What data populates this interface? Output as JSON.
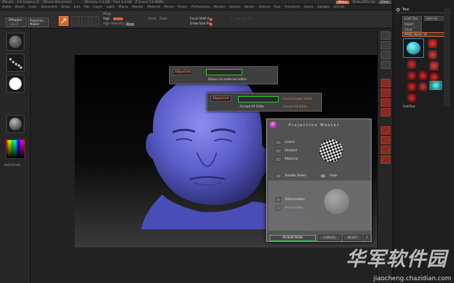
{
  "titlebar": {
    "items": [
      "ZBrush",
      "2.0 (Legacy 4)",
      "ZBrush Document",
      "Memory: 2.4 GB",
      "Free 3.4 GB",
      "Z-Scene 3.6 NBBV"
    ],
    "menu_button": "Menu",
    "default_script": "DefaultZScript",
    "clear": "Clear"
  },
  "menubar": {
    "items": [
      "Alpha",
      "Brush",
      "Color",
      "Document",
      "Draw",
      "Edit",
      "File",
      "Layer",
      "Light",
      "Macro",
      "Marker",
      "Material",
      "Movie",
      "Picker",
      "Preferences",
      "Render",
      "Stencil",
      "Stroke",
      "Texture",
      "Tool",
      "Transform",
      "Zoom",
      "Zplugin",
      "Zscript"
    ]
  },
  "toolbar": {
    "zmapper": "ZMapper",
    "zmapper_rev": "rev E",
    "projection_master": "Projection Master",
    "mrgb": "Mrgb",
    "rgb": "Rgb",
    "rgb_intensity": "Rgb Intensity 75",
    "zadd": "Zadd",
    "zsub": "Zsub",
    "focal_shift": "Focal Shift 0",
    "draw_size": "Draw Size 64",
    "z_intensity": "Z Intensity 25"
  },
  "left_shelf": {
    "color_label": "SwitchColor"
  },
  "tray": {
    "header": "Tool",
    "load_tool": "Load Tool",
    "save_as": "Save As",
    "import": "Import",
    "clone": "Clone",
    "current_tool": "PM3D_Merlin 19",
    "subtool_label": "SubTool"
  },
  "popups": {
    "return_to_editor": "Return to external editor",
    "cancel_layer_edits": "Cancel Layer Edits",
    "accept_all_edits": "Accept All Edits",
    "cancel_all_edits": "Cancel All Edits",
    "zapplink": "ZAppLink"
  },
  "projection_master": {
    "title": "Projection Master",
    "colors": "Colors",
    "shaded": "Shaded",
    "material": "Material",
    "double_sided": "Double Sided",
    "fade": "Fade",
    "deformation": "Deformation",
    "normalized": "Normalized",
    "pickup_now": "PICKUP NOW",
    "cancel": "CANCEL",
    "reset": "RESET",
    "help": "?"
  },
  "watermark": {
    "text": "华军软件园",
    "url": "jiaocheng.chazidian.com"
  },
  "colors": {
    "accent": "#d9652a",
    "highlight_box": "#2fcc3a",
    "head": "#6466d8"
  }
}
